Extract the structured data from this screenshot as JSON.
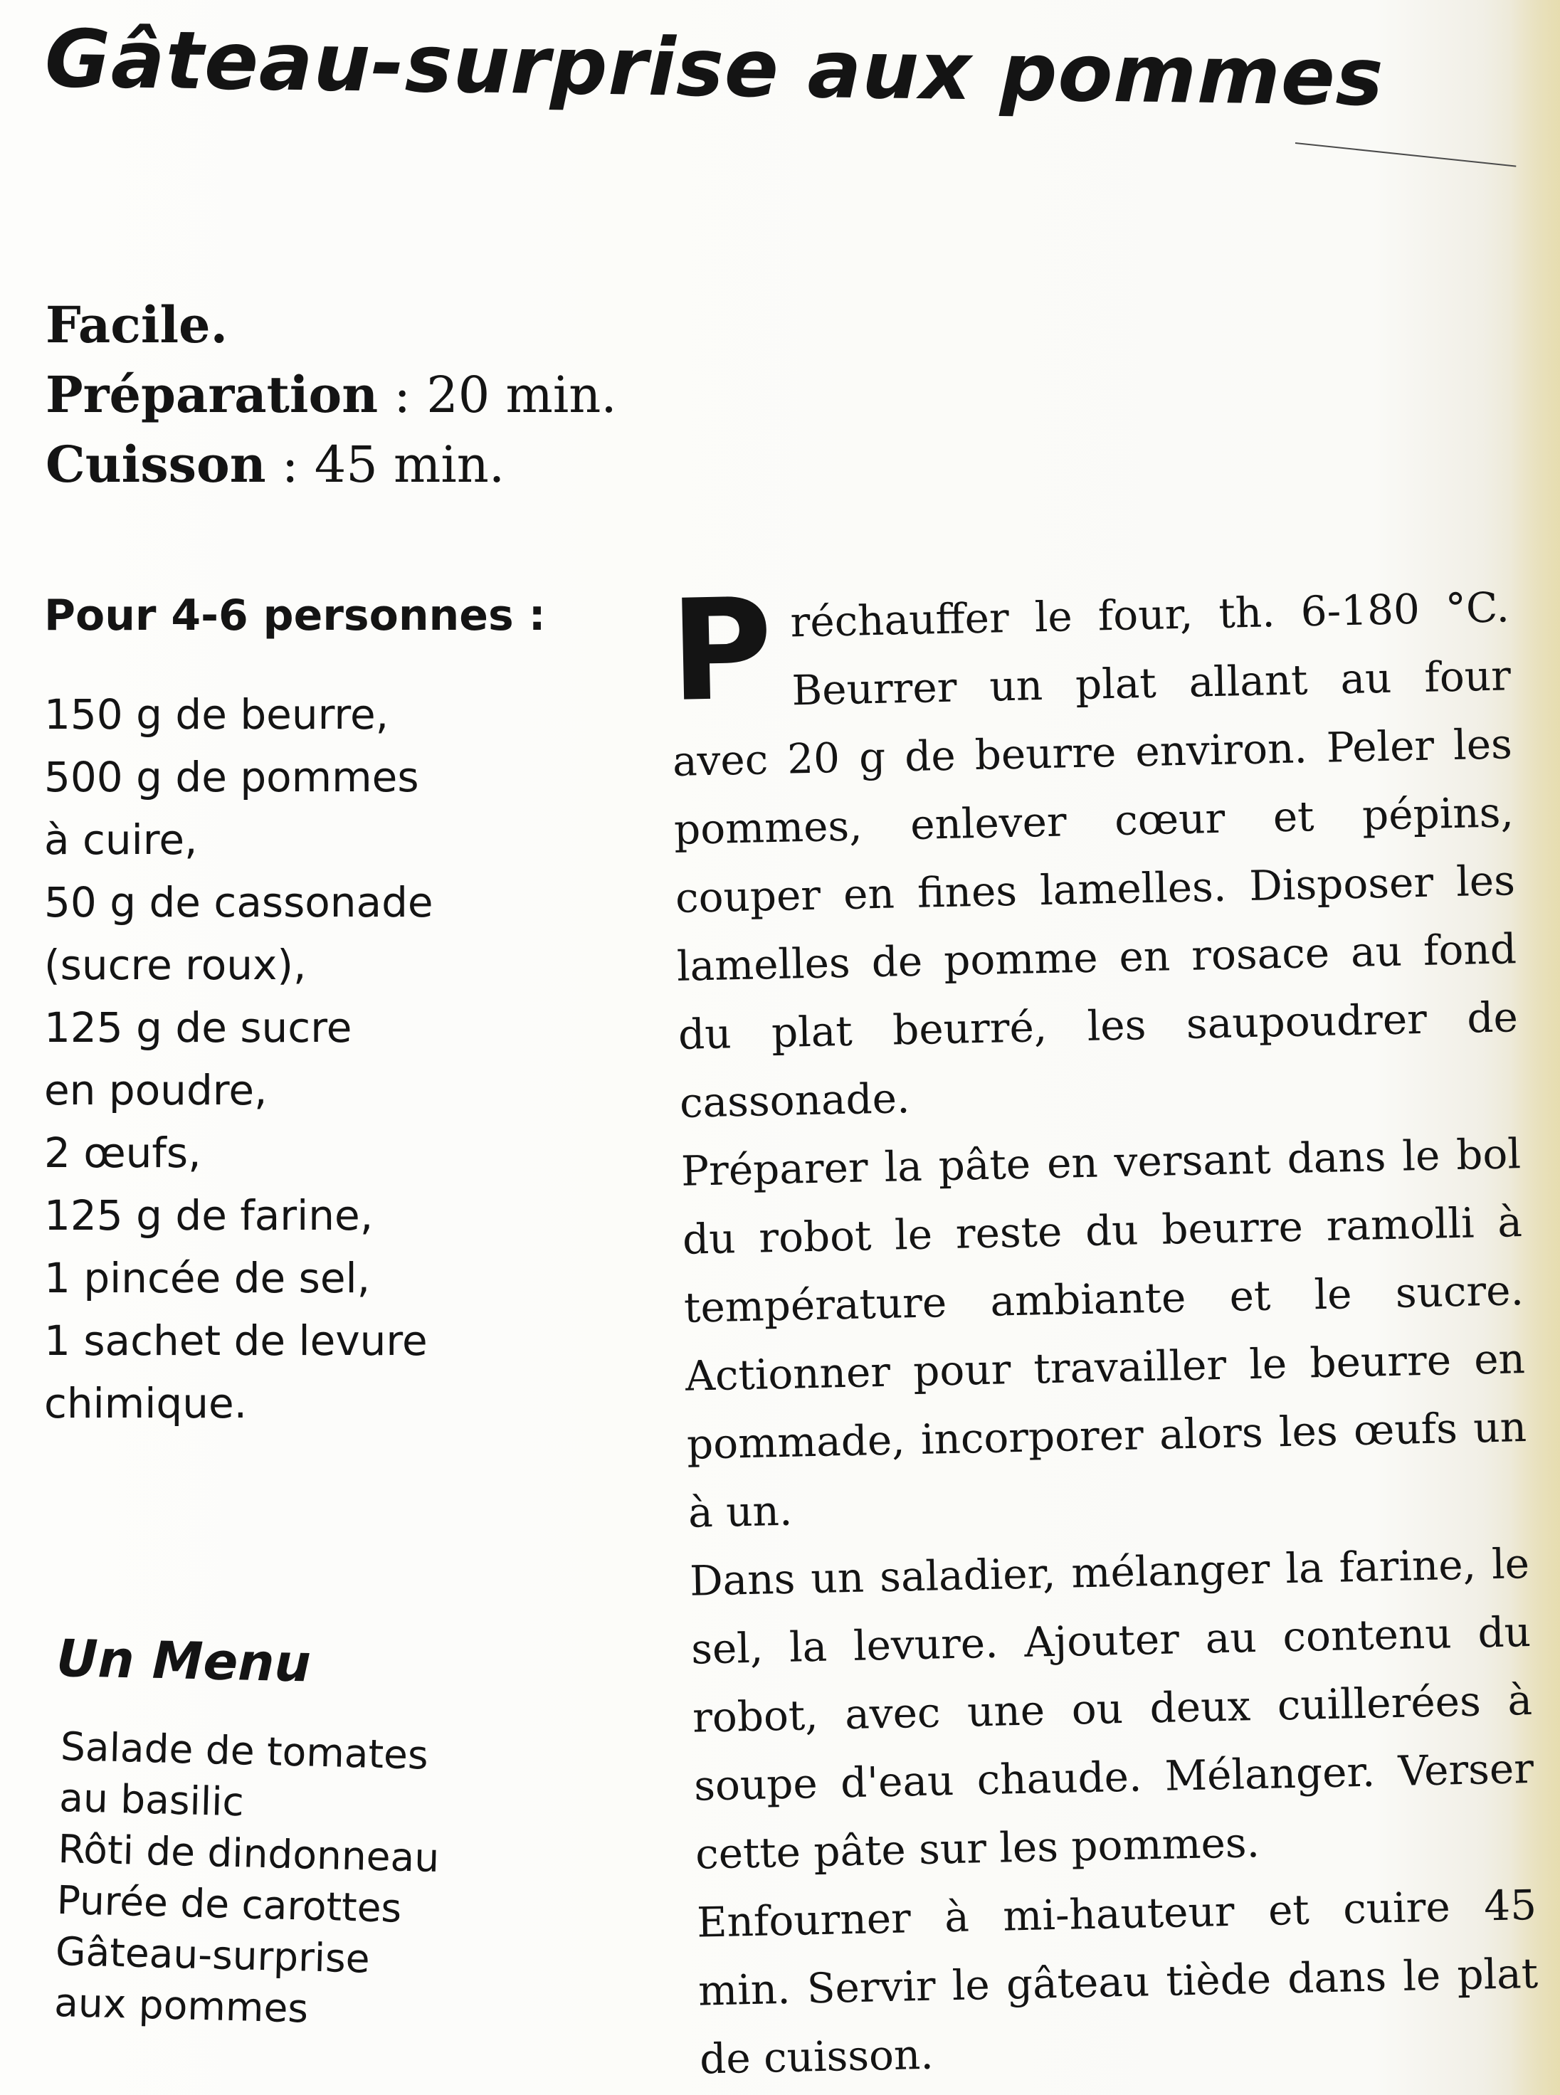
{
  "title": "Gâteau-surprise aux pommes",
  "meta": {
    "difficulty": "Facile.",
    "preparation_label": "Préparation",
    "preparation_value": " : 20 min.",
    "cuisson_label": "Cuisson",
    "cuisson_value": " : 45 min."
  },
  "ingredients": {
    "heading": "Pour 4-6 personnes :",
    "lines": [
      "150 g de beurre,",
      "500 g de pommes",
      "à cuire,",
      "50 g de cassonade",
      "(sucre roux),",
      "125 g de sucre",
      "en poudre,",
      "2 œufs,",
      "125 g de farine,",
      "1 pincée de sel,",
      "1 sachet de levure",
      "chimique."
    ]
  },
  "menu": {
    "heading": "Un Menu",
    "lines": [
      "Salade de tomates",
      "au basilic",
      "Rôti de dindonneau",
      "Purée de carottes",
      "Gâteau-surprise",
      "aux pommes"
    ]
  },
  "recipe": {
    "dropcap": "P",
    "paragraphs": [
      "réchauffer le four, th. 6-180 °C. Beurrer un plat allant au four avec 20 g de beurre environ. Peler les pommes, enlever cœur et pépins, couper en fines lamelles. Disposer les lamelles de pomme en rosace au fond du plat beurré, les saupoudrer de cassonade.",
      "Préparer la pâte en versant dans le bol du robot le reste du beurre ramolli à température ambiante et le sucre. Actionner pour travailler le beurre en pommade, incorporer alors les œufs un à un.",
      "Dans un saladier, mélanger la farine, le sel, la levure. Ajouter au contenu du robot, avec une ou deux cuillerées à soupe d'eau chaude. Mélanger. Verser cette pâte sur les pommes.",
      "Enfourner à mi-hauteur et cuire 45 min. Servir le gâteau tiède dans le plat de cuisson."
    ]
  }
}
